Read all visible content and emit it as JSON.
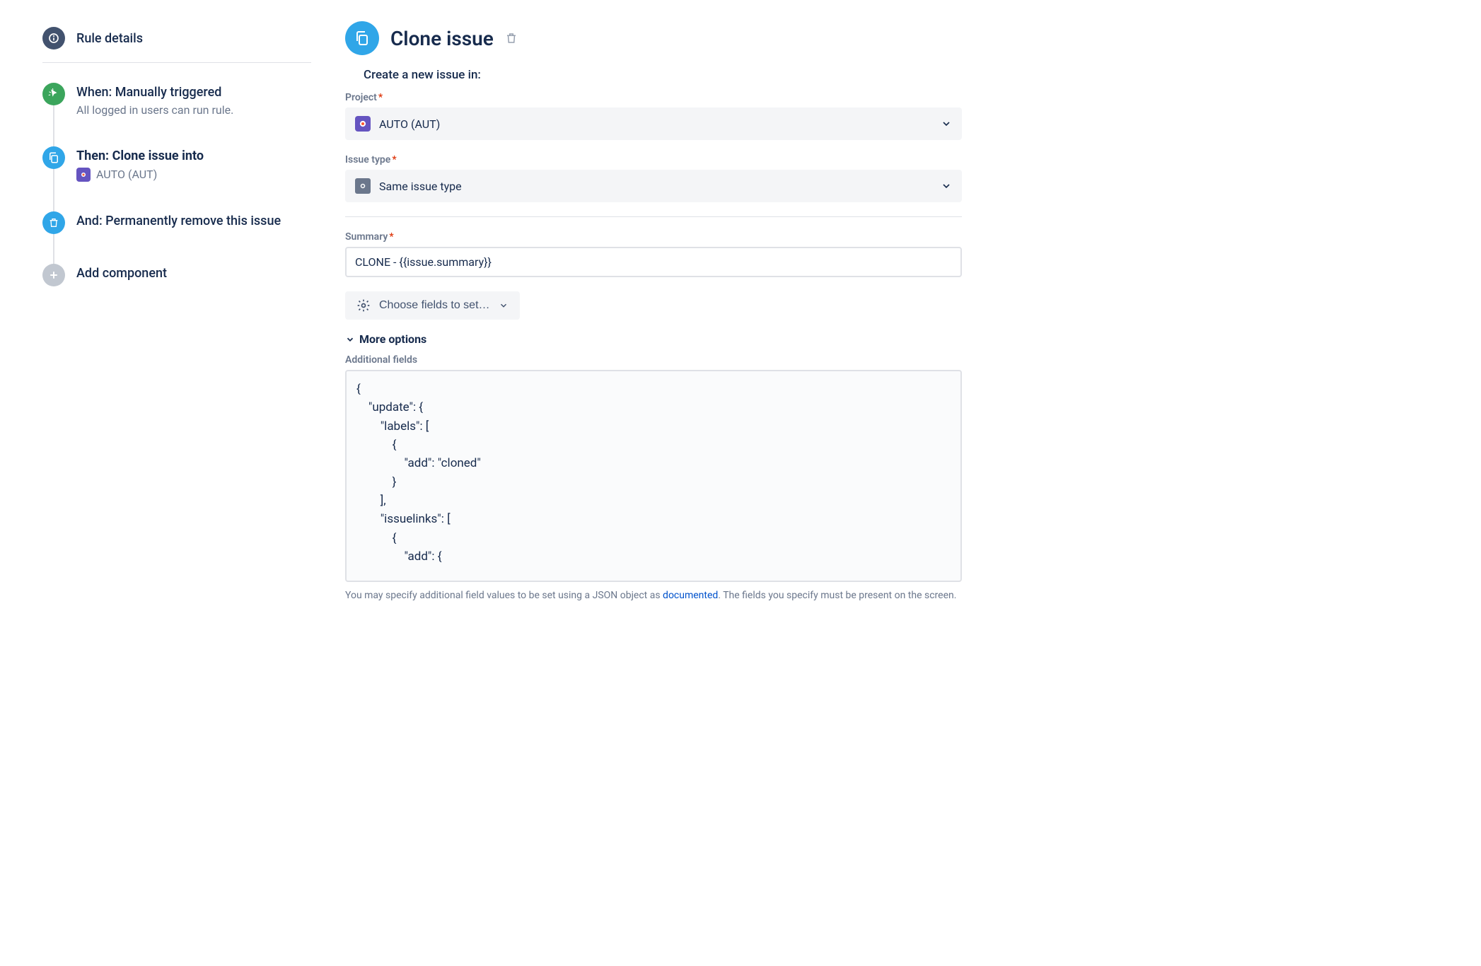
{
  "sidebar": {
    "rule_details_label": "Rule details",
    "steps": [
      {
        "title": "When: Manually triggered",
        "subtitle": "All logged in users can run rule."
      },
      {
        "title": "Then: Clone issue into",
        "project": "AUTO (AUT)"
      },
      {
        "title": "And: Permanently remove this issue"
      },
      {
        "title": "Add component"
      }
    ]
  },
  "main": {
    "title": "Clone issue",
    "section_label": "Create a new issue in:",
    "project": {
      "label": "Project",
      "value": "AUTO (AUT)"
    },
    "issue_type": {
      "label": "Issue type",
      "value": "Same issue type"
    },
    "summary": {
      "label": "Summary",
      "value": "CLONE - {{issue.summary}}"
    },
    "fields_button": "Choose fields to set…",
    "more_options": "More options",
    "additional_fields": {
      "label": "Additional fields",
      "value": "{\n    \"update\": {\n        \"labels\": [\n            {\n                \"add\": \"cloned\"\n            }\n        ],\n        \"issuelinks\": [\n            {\n                \"add\": {"
    },
    "help_text_pre": "You may specify additional field values to be set using a JSON object as ",
    "help_link": "documented",
    "help_text_post": ". The fields you specify must be present on the screen."
  }
}
